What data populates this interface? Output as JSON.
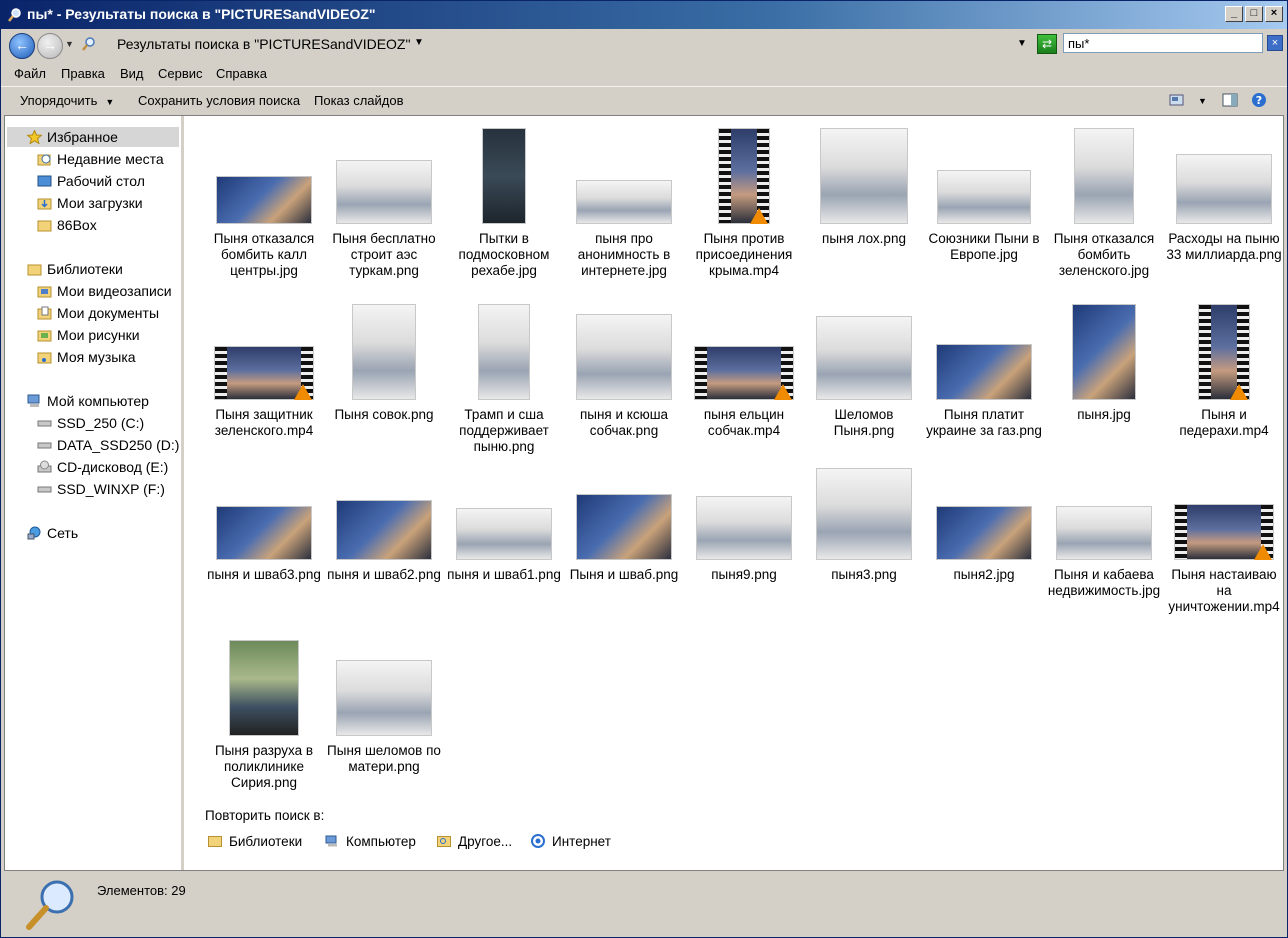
{
  "window": {
    "title": "пы* - Результаты поиска в \"PICTURESandVIDEOZ\""
  },
  "address": {
    "text": "Результаты поиска в \"PICTURESandVIDEOZ\""
  },
  "search": {
    "value": "пы*"
  },
  "menu": [
    "Файл",
    "Правка",
    "Вид",
    "Сервис",
    "Справка"
  ],
  "toolbar": {
    "organize": "Упорядочить",
    "save_search": "Сохранить условия поиска",
    "slideshow": "Показ слайдов"
  },
  "sidebar": {
    "favorites": "Избранное",
    "recent": "Недавние места",
    "desktop": "Рабочий стол",
    "downloads": "Мои загрузки",
    "box86": "86Box",
    "libraries": "Библиотеки",
    "videos": "Мои видеозаписи",
    "documents": "Мои документы",
    "pictures": "Мои рисунки",
    "music": "Моя музыка",
    "computer": "Мой компьютер",
    "drive_c": "SSD_250 (C:)",
    "drive_d": "DATA_SSD250 (D:)",
    "drive_e": "CD-дисковод (E:)",
    "drive_f": "SSD_WINXP (F:)",
    "network": "Сеть"
  },
  "files": [
    "Пыня отказался бомбить калл центры.jpg",
    "Пыня бесплатно строит аэс туркам.png",
    "Пытки в подмосковном рехабе.jpg",
    "пыня про анонимность в интернете.jpg",
    "Пыня против присоединения крыма.mp4",
    "пыня лох.png",
    "Союзники Пыни в Европе.jpg",
    "Пыня отказался бомбить зеленского.jpg",
    "Расходы на пыню 33 миллиарда.png",
    "Пыня защитник зеленского.mp4",
    "Пыня совок.png",
    "Трамп и сша поддерживает пыню.png",
    "пыня и ксюша собчак.png",
    "пыня ельцин собчак.mp4",
    "Шеломов Пыня.png",
    "Пыня платит украине за газ.png",
    "пыня.jpg",
    "Пыня и педерахи.mp4",
    "пыня и шваб3.png",
    "пыня и шваб2.png",
    "пыня и шваб1.png",
    "Пыня и шваб.png",
    "пыня9.png",
    "пыня3.png",
    "пыня2.jpg",
    "Пыня и кабаева недвижимость.jpg",
    "Пыня настаиваю на уничтожении.mp4",
    "Пыня разруха в поликлинике Сирия.png",
    "Пыня шеломов по матери.png"
  ],
  "search_again": {
    "label": "Повторить поиск в:",
    "libraries": "Библиотеки",
    "computer": "Компьютер",
    "other": "Другое...",
    "internet": "Интернет"
  },
  "status": {
    "items": "Элементов: 29"
  }
}
